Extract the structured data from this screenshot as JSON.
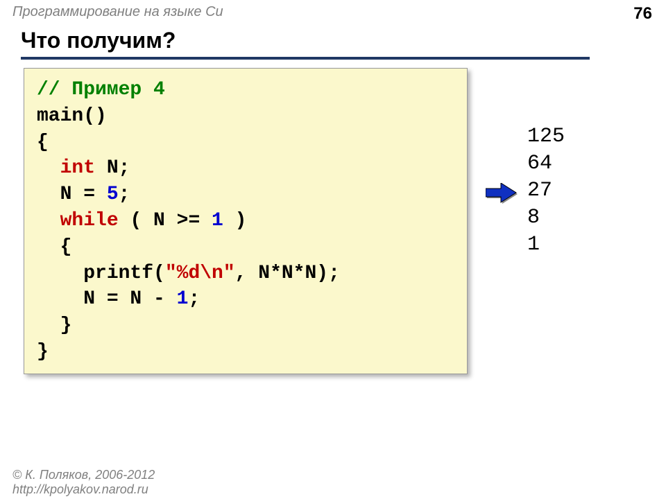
{
  "header": "Программирование на языке Си",
  "page_num": "76",
  "title": "Что получим?",
  "code": {
    "l1": "// Пример 4",
    "l2": "main()",
    "l3": "{",
    "l4_kw": "int",
    "l4_rest": " N;",
    "l5_a": "  N = ",
    "l5_num": "5",
    "l5_b": ";",
    "l6_kw": "while",
    "l6_a": " ( N >= ",
    "l6_num": "1",
    "l6_b": " )",
    "l7": "  {",
    "l8_a": "    printf(",
    "l8_str": "\"%d\\n\"",
    "l8_b": ", N*N*N);",
    "l9_a": "    N = N - ",
    "l9_num": "1",
    "l9_b": ";",
    "l10": "  }",
    "l11": "}"
  },
  "output": "125\n64\n27\n8\n1",
  "footer_line1": "© К. Поляков, 2006-2012",
  "footer_line2": "http://kpolyakov.narod.ru"
}
